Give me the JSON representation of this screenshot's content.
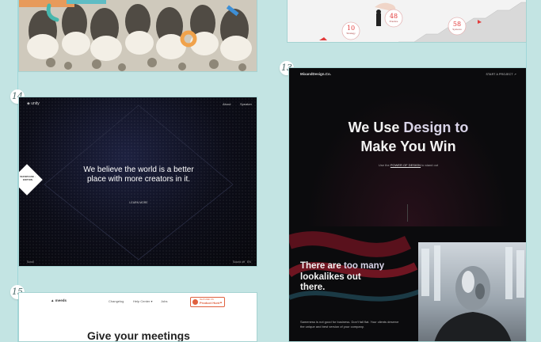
{
  "colors": {
    "background": "#c3e4e3",
    "accent_red": "#e23b3b",
    "accent_teal": "#3fb7b7"
  },
  "cards": {
    "top_right": {
      "stats": [
        {
          "value": "10",
          "label": "Strategy"
        },
        {
          "value": "48",
          "label": "Practice"
        },
        {
          "value": "58",
          "label": "Systems"
        }
      ]
    },
    "c13": {
      "number": "13",
      "logo": "MixandDesign.Co.",
      "nav_cta": "START A PROJECT  ↗",
      "headline_1a": "We Use ",
      "headline_1b": "Design to",
      "headline_2": "Make You Win",
      "sub_prefix": "Use the ",
      "sub_link": "POWER OF DESIGN",
      "sub_suffix": " to stand out",
      "lower_title_1a": "There are ",
      "lower_title_1b": "too many",
      "lower_title_2": "lookalikes out",
      "lower_title_3": "there.",
      "lower_body": "Sameness is not good for business. Don't fall flat. Your clients deserve the unique and best version of your company."
    },
    "c14": {
      "number": "14",
      "logo": "unity",
      "nav": [
        "About",
        "Speaker"
      ],
      "badge": "SHOWCASE · EDITION",
      "headline": "We believe the world is a better place with more creators in it.",
      "cta": "LEARN MORE",
      "footer_left": "Scroll",
      "footer_right": "Sound off",
      "footer_right_2": "EN"
    },
    "c15": {
      "number": "15",
      "logo": "meeds",
      "nav": [
        "Changelog",
        "Help Center ▾",
        "Jobs"
      ],
      "badge_top": "FEATURED ON",
      "badge_main": "Product Hunt",
      "badge_count": "▲",
      "headline": "Give your meetings"
    }
  }
}
